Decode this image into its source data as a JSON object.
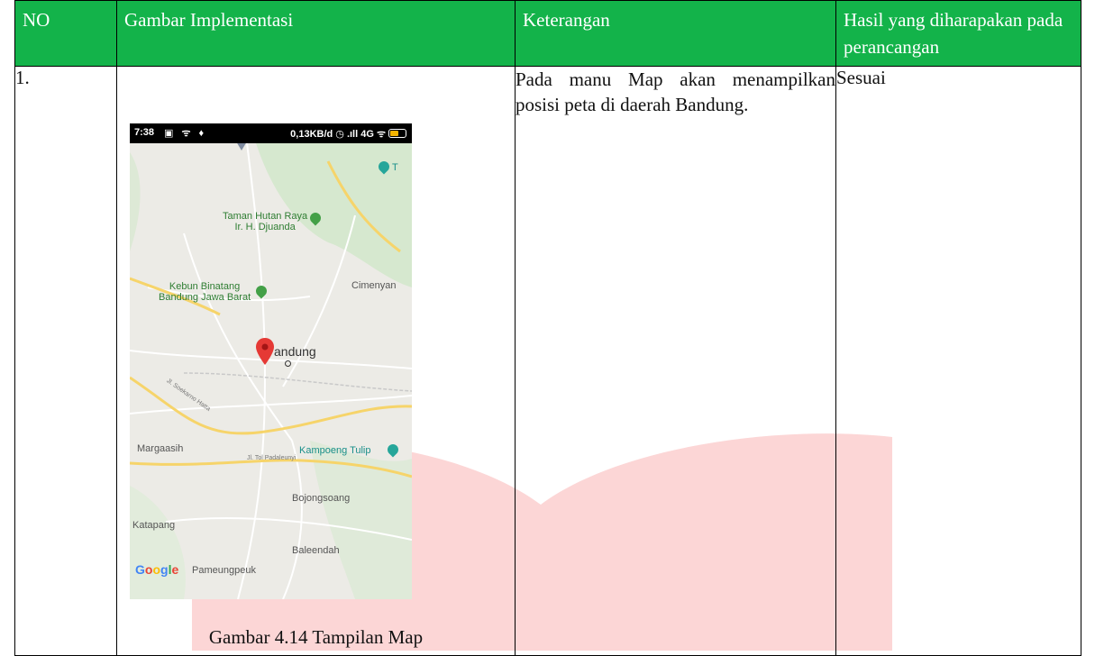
{
  "table": {
    "headers": {
      "no": "NO",
      "gambar": "Gambar Implementasi",
      "keterangan": "Keterangan",
      "hasil": "Hasil yang diharapakan pada perancangan"
    },
    "rows": [
      {
        "no": "1.",
        "keterangan": "Pada manu Map akan menampilkan posisi peta di daerah Bandung.",
        "hasil": "Sesuai",
        "caption": "Gambar 4.14 Tampilan Map"
      }
    ]
  },
  "phone": {
    "status_time": "7:38",
    "status_right": "0,13KB/d ◷ .ıll 4G ᯤ",
    "map_labels": {
      "taman_hutan": "Taman Hutan Raya\nIr. H. Djuanda",
      "kebun_binatang": "Kebun Binatang\nBandung Jawa Barat",
      "cimenyan": "Cimenyan",
      "bandung": "andung",
      "margaasih": "Margaasih",
      "kampoeng_tulip": "Kampoeng Tulip",
      "bojongsoang": "Bojongsoang",
      "katapang": "Katapang",
      "baleendah": "Baleendah",
      "pameungpeuk": "Pameungpeuk",
      "road_soekarno": "Jl. Soekarno Hatta",
      "road_tol": "Jl. Tol Padaleunyi",
      "poi_t": "T"
    },
    "google_logo": "Google"
  },
  "colors": {
    "header_bg": "#13b34a",
    "watermark": "#fcd6d6",
    "pin": "#e53935"
  },
  "icons": [
    "map-pin-icon",
    "poi-park-icon",
    "poi-attraction-icon",
    "wifi-icon",
    "battery-icon"
  ]
}
